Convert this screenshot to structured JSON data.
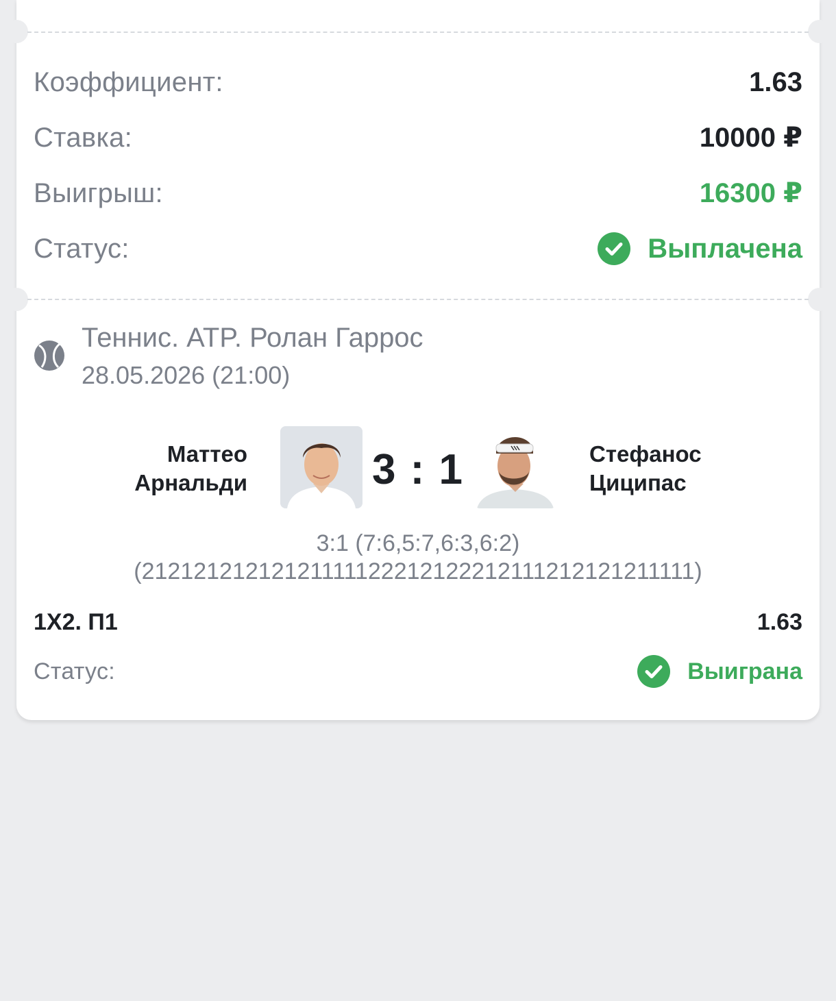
{
  "summary": {
    "coef_label": "Коэффициент:",
    "coef_value": "1.63",
    "stake_label": "Ставка:",
    "stake_value": "10000 ₽",
    "win_label": "Выигрыш:",
    "win_value": "16300 ₽",
    "status_label": "Статус:",
    "status_value": "Выплачена"
  },
  "event": {
    "sport_icon": "tennis-ball-icon",
    "title": "Теннис. ATP. Ролан Гаррос",
    "date": "28.05.2026 (21:00)",
    "home": {
      "first": "Маттео",
      "last": "Арнальди"
    },
    "away": {
      "first": "Стефанос",
      "last": "Циципас"
    },
    "score": "3 : 1",
    "sets_line1": "3:1 (7:6,5:7,6:3,6:2)",
    "sets_line2": "(21212121212121111122212122212111212121211111)",
    "market": "1X2. П1",
    "market_coef": "1.63",
    "status_label": "Статус:",
    "status_value": "Выиграна"
  },
  "colors": {
    "accent_green": "#3dab5b",
    "muted_text": "#7b808a",
    "background": "#ecedef"
  }
}
